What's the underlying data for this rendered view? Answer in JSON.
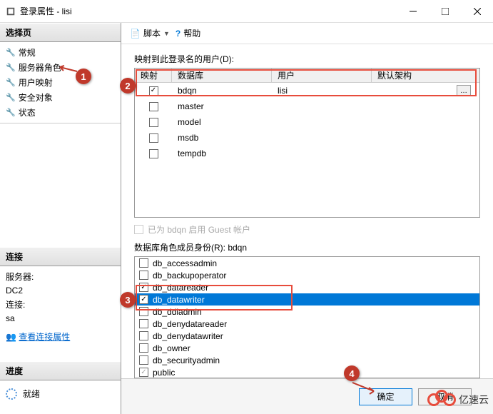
{
  "window": {
    "title": "登录属性 - lisi"
  },
  "toolbar": {
    "script": "脚本",
    "help": "帮助"
  },
  "sidebar": {
    "select_page": "选择页",
    "pages": [
      {
        "label": "常规"
      },
      {
        "label": "服务器角色"
      },
      {
        "label": "用户映射"
      },
      {
        "label": "安全对象"
      },
      {
        "label": "状态"
      }
    ],
    "connection_header": "连接",
    "server_label": "服务器:",
    "server_value": "DC2",
    "conn_label": "连接:",
    "conn_value": "sa",
    "view_props": "查看连接属性",
    "progress_header": "进度",
    "progress_status": "就绪"
  },
  "content": {
    "mapped_users_label": "映射到此登录名的用户(D):",
    "columns": {
      "map": "映射",
      "db": "数据库",
      "user": "用户",
      "schema": "默认架构"
    },
    "rows": [
      {
        "checked": true,
        "db": "bdqn",
        "user": "lisi",
        "schema_btn": true
      },
      {
        "checked": false,
        "db": "master",
        "user": ""
      },
      {
        "checked": false,
        "db": "model",
        "user": ""
      },
      {
        "checked": false,
        "db": "msdb",
        "user": ""
      },
      {
        "checked": false,
        "db": "tempdb",
        "user": ""
      }
    ],
    "guest_label": "已为 bdqn 启用 Guest 帐户",
    "role_label": "数据库角色成员身份(R): bdqn",
    "roles": [
      {
        "checked": false,
        "name": "db_accessadmin"
      },
      {
        "checked": false,
        "name": "db_backupoperator"
      },
      {
        "checked": true,
        "name": "db_datareader"
      },
      {
        "checked": true,
        "name": "db_datawriter",
        "selected": true
      },
      {
        "checked": false,
        "name": "db_ddladmin"
      },
      {
        "checked": false,
        "name": "db_denydatareader"
      },
      {
        "checked": false,
        "name": "db_denydatawriter"
      },
      {
        "checked": false,
        "name": "db_owner"
      },
      {
        "checked": false,
        "name": "db_securityadmin"
      },
      {
        "checked": true,
        "name": "public"
      }
    ]
  },
  "buttons": {
    "ok": "确定",
    "cancel": "取消"
  },
  "annotations": {
    "a1": "1",
    "a2": "2",
    "a3": "3",
    "a4": "4"
  },
  "watermark": "亿速云"
}
